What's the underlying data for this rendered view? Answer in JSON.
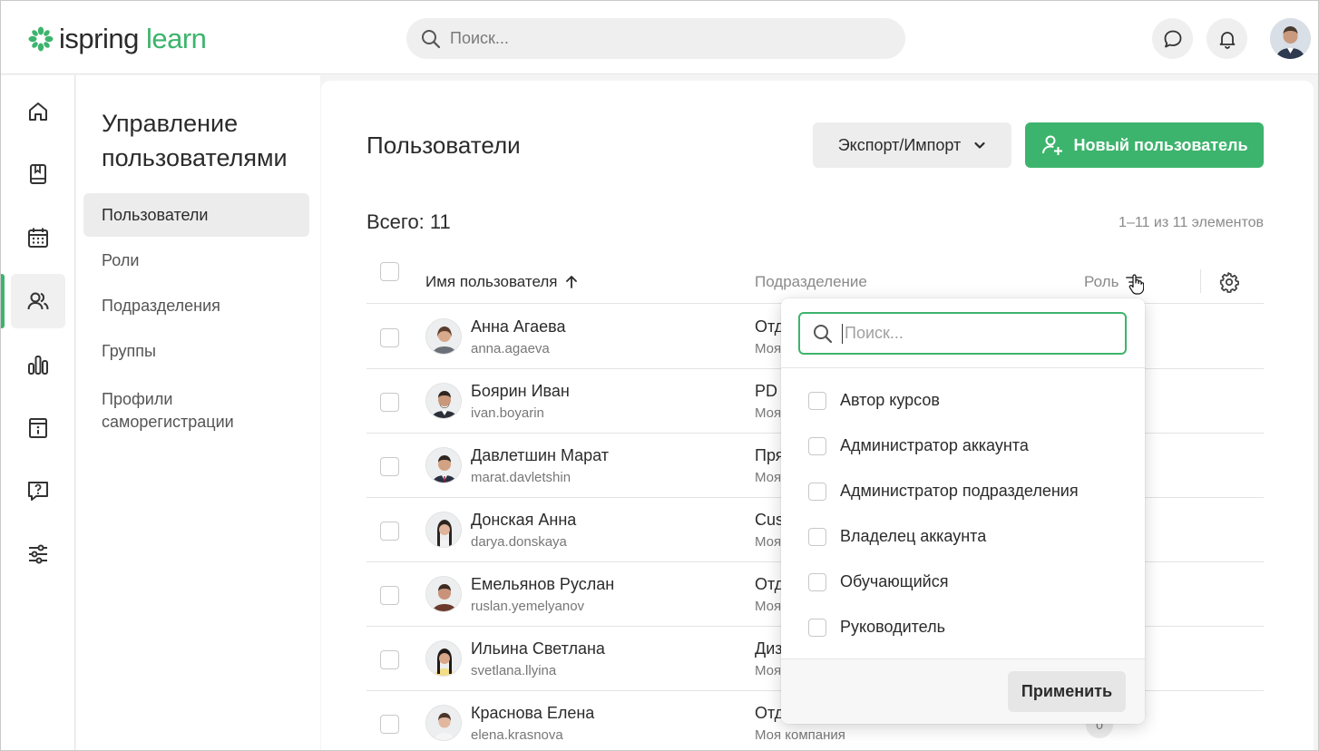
{
  "app": {
    "logo_part1": "ispring",
    "logo_part2": "learn",
    "brand_color": "#3db46d"
  },
  "header": {
    "search_placeholder": "Поиск...",
    "icons": [
      "chat-icon",
      "bell-icon"
    ]
  },
  "rail": {
    "items": [
      "home-icon",
      "book-icon",
      "calendar-icon",
      "users-icon",
      "chart-icon",
      "info-board-icon",
      "question-icon",
      "settings-sliders-icon"
    ],
    "active": "users-icon"
  },
  "subnav": {
    "title": "Управление пользователями",
    "items": [
      {
        "label": "Пользователи",
        "active": true
      },
      {
        "label": "Роли"
      },
      {
        "label": "Подразделения"
      },
      {
        "label": "Группы"
      },
      {
        "label": "Профили саморегистрации"
      }
    ]
  },
  "main": {
    "title": "Пользователи",
    "export_label": "Экспорт/Импорт",
    "new_user_label": "Новый пользователь",
    "total": "Всего: 11",
    "range": "1–11 из 11 элементов",
    "columns": {
      "name": "Имя пользователя",
      "dept": "Подразделение",
      "role": "Роль"
    },
    "rows": [
      {
        "name": "Анна Агаева",
        "login": "anna.agaeva",
        "dept": "Отд",
        "dept_sub": "Моя",
        "badge_green": true
      },
      {
        "name": "Боярин Иван",
        "login": "ivan.boyarin",
        "dept": "PD",
        "dept_sub": "Моя",
        "badge_green": false
      },
      {
        "name": "Давлетшин Марат",
        "login": "marat.davletshin",
        "dept": "Пря",
        "dept_sub": "Моя",
        "badge_green": true
      },
      {
        "name": "Донская Анна",
        "login": "darya.donskaya",
        "dept": "Cus",
        "dept_sub": "Моя",
        "badge_green": false
      },
      {
        "name": "Емельянов Руслан",
        "login": "ruslan.yemelyanov",
        "dept": "Отд",
        "dept_sub": "Моя",
        "badge_green": false
      },
      {
        "name": "Ильина Светлана",
        "login": "svetlana.llyina",
        "dept": "Диз",
        "dept_sub": "Моя",
        "badge_green": false
      },
      {
        "name": "Краснова Елена",
        "login": "elena.krasnova",
        "dept": "Отд",
        "dept_sub": "Моя компания",
        "badge": "0"
      }
    ]
  },
  "role_filter": {
    "search_placeholder": "Поиск...",
    "options": [
      "Автор курсов",
      "Администратор аккаунта",
      "Администратор подразделения",
      "Владелец аккаунта",
      "Обучающийся",
      "Руководитель"
    ],
    "apply_label": "Применить"
  }
}
